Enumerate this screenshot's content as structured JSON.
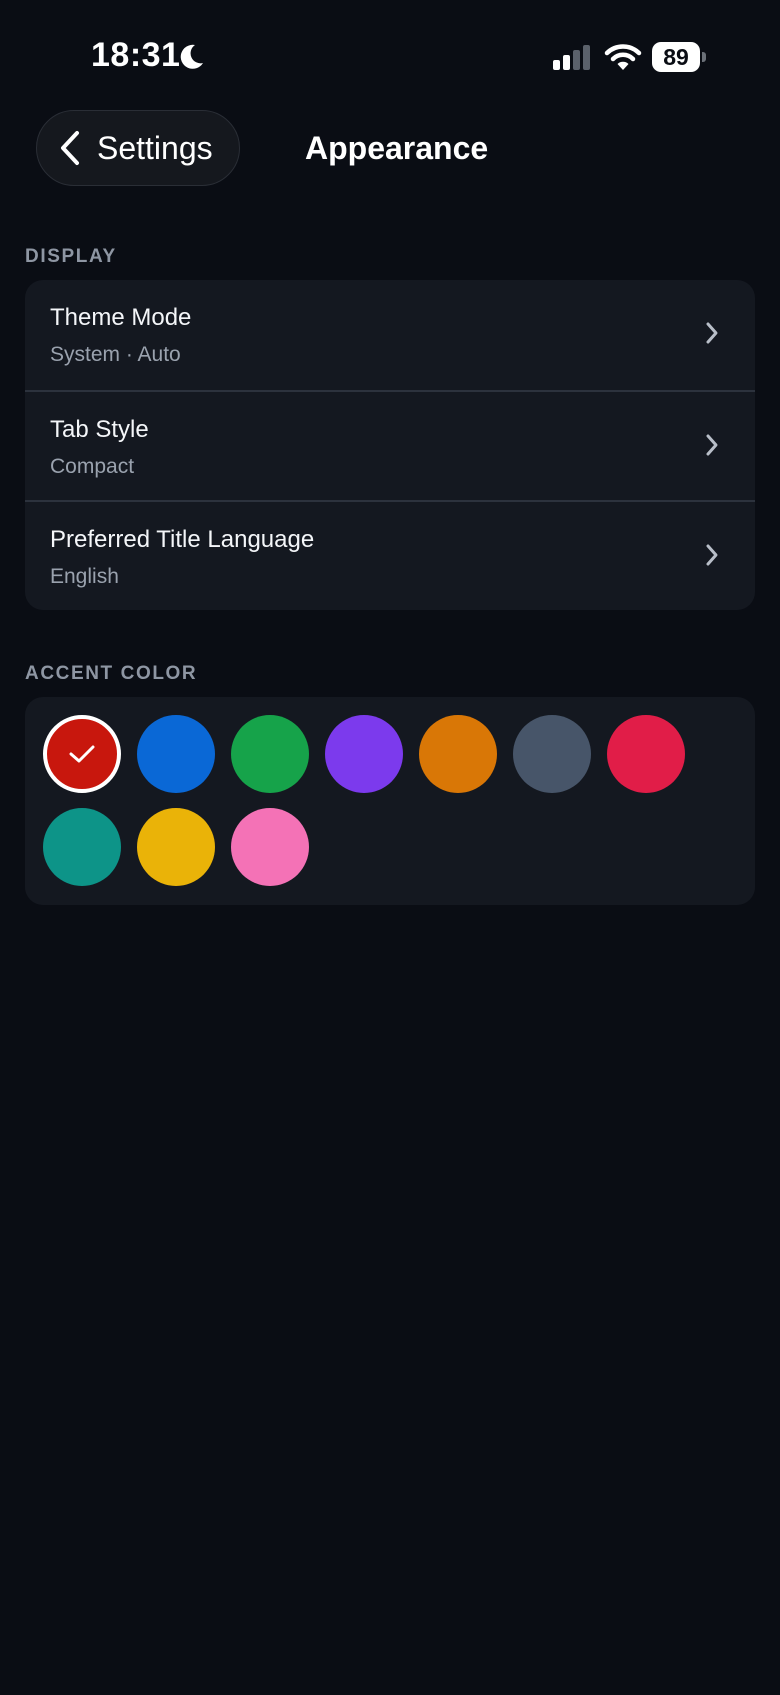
{
  "status_bar": {
    "time": "18:31",
    "battery": "89",
    "icons": [
      "moon-icon",
      "cellular-signal-icon",
      "wifi-icon",
      "battery-icon"
    ]
  },
  "nav": {
    "back_label": "Settings",
    "title": "Appearance"
  },
  "display": {
    "header": "DISPLAY",
    "rows": [
      {
        "title": "Theme Mode",
        "subtitle": "System · Auto"
      },
      {
        "title": "Tab Style",
        "subtitle": "Compact"
      },
      {
        "title": "Preferred Title Language",
        "subtitle": "English"
      }
    ]
  },
  "accent": {
    "header": "ACCENT COLOR",
    "selected": "red",
    "swatches": [
      {
        "name": "red",
        "color": "#c8170d"
      },
      {
        "name": "blue",
        "color": "#0a68d6"
      },
      {
        "name": "green",
        "color": "#16a34a"
      },
      {
        "name": "purple",
        "color": "#7c3aed"
      },
      {
        "name": "orange",
        "color": "#d97706"
      },
      {
        "name": "slate",
        "color": "#475569"
      },
      {
        "name": "crimson",
        "color": "#e11d48"
      },
      {
        "name": "teal",
        "color": "#0d9488"
      },
      {
        "name": "yellow",
        "color": "#eab308"
      },
      {
        "name": "pink",
        "color": "#f472b6"
      }
    ]
  },
  "colors": {
    "background": "#0a0d14",
    "card": "#141820",
    "divider": "#2c323d",
    "secondary_text": "#9aa2ae",
    "section_header": "#8e96a3"
  }
}
